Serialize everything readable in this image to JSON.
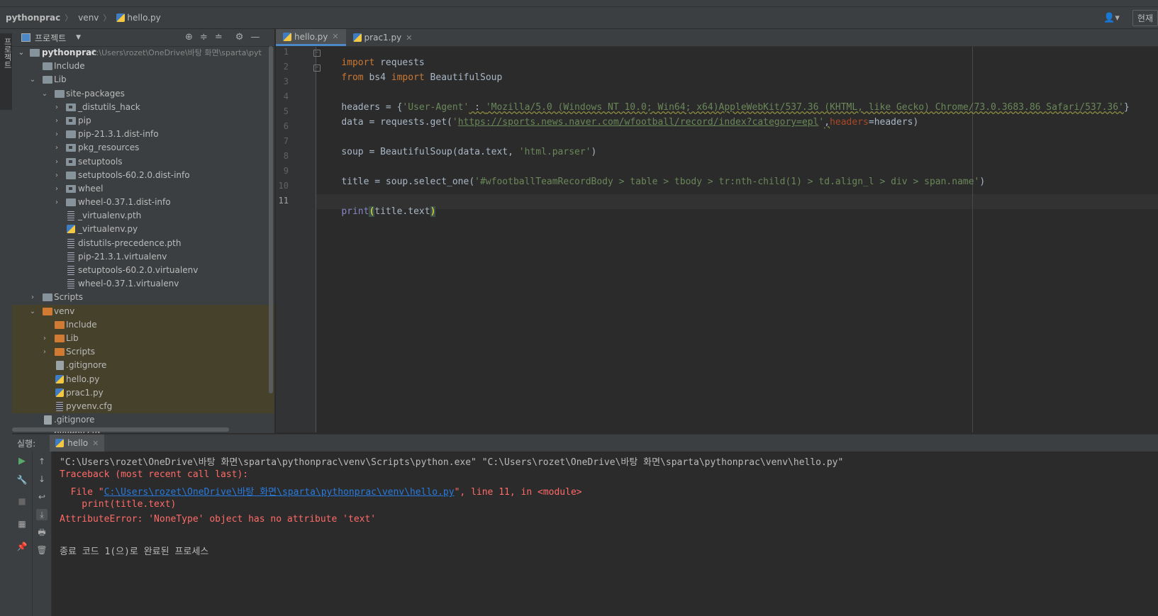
{
  "navbar": {
    "crumbs": [
      "pythonprac",
      "venv",
      "hello.py"
    ],
    "current_button": "현재"
  },
  "left_strip": {
    "project_tab": "프로젝트"
  },
  "project": {
    "title": "프로젝트",
    "root_name": "pythonprac",
    "root_path": "C:\\Users\\rozet\\OneDrive\\바탕 화면\\sparta\\pyt",
    "items": [
      "Include",
      "Lib",
      "site-packages",
      "_distutils_hack",
      "pip",
      "pip-21.3.1.dist-info",
      "pkg_resources",
      "setuptools",
      "setuptools-60.2.0.dist-info",
      "wheel",
      "wheel-0.37.1.dist-info",
      "_virtualenv.pth",
      "_virtualenv.py",
      "distutils-precedence.pth",
      "pip-21.3.1.virtualenv",
      "setuptools-60.2.0.virtualenv",
      "wheel-0.37.1.virtualenv",
      "Scripts",
      "venv",
      "Include",
      "Lib",
      "Scripts",
      ".gitignore",
      "hello.py",
      "prac1.py",
      "pyvenv.cfg",
      ".gitignore",
      "pyvenv.cfg"
    ]
  },
  "editor": {
    "tabs": [
      "hello.py",
      "prac1.py"
    ],
    "line_numbers": [
      "1",
      "2",
      "3",
      "4",
      "5",
      "6",
      "7",
      "8",
      "9",
      "10",
      "11"
    ],
    "code": {
      "l1_kw": "import",
      "l1_rest": " requests",
      "l2_kw1": "from",
      "l2_mod": " bs4 ",
      "l2_kw2": "import",
      "l2_rest": " BeautifulSoup",
      "l4_pre": "headers = {",
      "l4_key": "'User-Agent'",
      "l4_colon": " : ",
      "l4_val": "'Mozilla/5.0 (Windows NT 10.0; Win64; x64)AppleWebKit/537.36 (KHTML, like Gecko) Chrome/73.0.3683.86 Safari/537.36'",
      "l4_post": "}",
      "l5_pre": "data = requests.get(",
      "l5_q1": "'",
      "l5_url": "https://sports.news.naver.com/wfootball/record/index?category=epl",
      "l5_q2": "'",
      "l5_comma": ",",
      "l5_param": "headers",
      "l5_post": "=headers)",
      "l7_pre": "soup = BeautifulSoup(data.text, ",
      "l7_str": "'html.parser'",
      "l7_post": ")",
      "l9_pre": "title = soup.select_one(",
      "l9_str": "'#wfootballTeamRecordBody > table > tbody > tr:nth-child(1) > td.align_l > div > span.name'",
      "l9_post": ")",
      "l11_fn": "print",
      "l11_open": "(",
      "l11_mid": "title.text",
      "l11_close": ")"
    }
  },
  "run": {
    "label": "실행:",
    "tab": "hello",
    "output": {
      "cmd": "\"C:\\Users\\rozet\\OneDrive\\바탕 화면\\sparta\\pythonprac\\venv\\Scripts\\python.exe\" \"C:\\Users\\rozet\\OneDrive\\바탕 화면\\sparta\\pythonprac\\venv\\hello.py\"",
      "traceback": "Traceback (most recent call last):",
      "file_pre": "  File \"",
      "file_link": "C:\\Users\\rozet\\OneDrive\\바탕 화면\\sparta\\pythonprac\\venv\\hello.py",
      "file_post": "\", line 11, in <module>",
      "code_line": "    print(title.text)",
      "error": "AttributeError: 'NoneType' object has no attribute 'text'",
      "exit": "종료 코드 1(으)로 완료된 프로세스"
    }
  }
}
